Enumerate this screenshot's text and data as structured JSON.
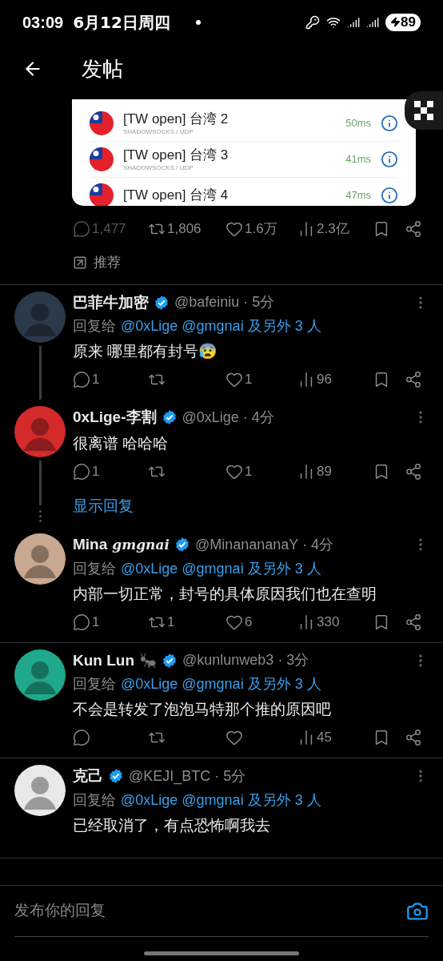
{
  "status_bar": {
    "time": "03:09",
    "date": "6月12日周四",
    "battery": "89"
  },
  "header": {
    "title": "发帖"
  },
  "embedded_image": {
    "rows": [
      {
        "title": "[TW open] 台湾 2",
        "subtitle": "SHADOWSOCKS / UDP",
        "latency": "50ms"
      },
      {
        "title": "[TW open] 台湾 3",
        "subtitle": "SHADOWSOCKS / UDP",
        "latency": "41ms"
      },
      {
        "title": "[TW open] 台湾 4",
        "latency": "47ms"
      }
    ]
  },
  "post_stats": {
    "replies": "1,477",
    "reposts": "1,806",
    "likes": "1.6万",
    "views": "2.3亿"
  },
  "recommended": "推荐",
  "replies": [
    {
      "name": "巴菲牛加密",
      "verified": true,
      "handle_line": "@bafeiniu · 5分",
      "color": "#2a3a4a",
      "reply_to": {
        "prefix": "回复给",
        "users": "@0xLige @gmgnai 及另外 3 人"
      },
      "text": "原来 哪里都有封号😰",
      "stats": {
        "replies": "1",
        "likes": "1",
        "views": "96"
      },
      "thread": true
    },
    {
      "name": "0xLige-李割",
      "verified": true,
      "handle_line": "@0xLige · 4分",
      "color": "#d42a2a",
      "text": "很离谱 哈哈哈",
      "stats": {
        "replies": "1",
        "likes": "1",
        "views": "89"
      },
      "thread": true,
      "show_replies": "显示回复"
    },
    {
      "name": "Mina",
      "name_tag": "gmgnai",
      "verified": true,
      "handle_line": "@MinanananaY · 4分",
      "color": "#c8a890",
      "reply_to": {
        "prefix": "回复给",
        "users": "@0xLige @gmgnai 及另外 3 人"
      },
      "text": "内部一切正常，封号的具体原因我们也在查明",
      "stats": {
        "replies": "1",
        "reposts": "1",
        "likes": "6",
        "views": "330"
      },
      "thread": false
    },
    {
      "name": "Kun Lun",
      "name_icon": true,
      "verified": true,
      "handle_line": "@kunlunweb3 · 3分",
      "color": "#1fa88a",
      "reply_to": {
        "prefix": "回复给",
        "users": "@0xLige @gmgnai 及另外 3 人"
      },
      "text": "不会是转发了泡泡马特那个推的原因吧",
      "stats": {
        "views": "45"
      },
      "thread": false
    },
    {
      "name": "克己",
      "verified": true,
      "handle_line": "@KEJI_BTC · 5分",
      "color": "#e8e8e8",
      "reply_to": {
        "prefix": "回复给",
        "users": "@0xLige @gmgnai 及另外 3 人"
      },
      "text": "已经取消了，有点恐怖啊我去",
      "thread": false
    }
  ],
  "composer": {
    "placeholder": "发布你的回复"
  }
}
